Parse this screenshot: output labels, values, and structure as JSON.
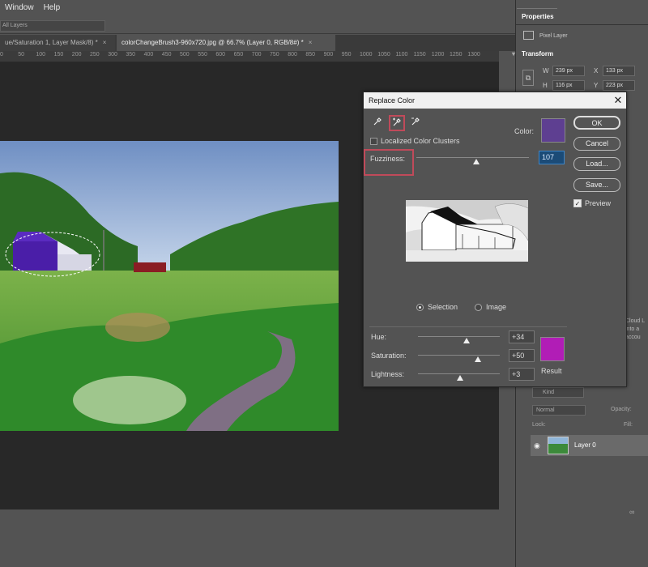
{
  "menu": {
    "items": [
      "Window",
      "Help"
    ]
  },
  "options_bar": {
    "layers_dropdown": "All Layers"
  },
  "tabs": [
    {
      "label": "ue/Saturation 1, Layer Mask/8) *"
    },
    {
      "label": "colorChangeBrush3-960x720.jpg @ 66.7% (Layer 0, RGB/8#) *"
    }
  ],
  "tab_close_glyph": "×",
  "ruler": {
    "ticks": [
      "0",
      "50",
      "100",
      "150",
      "200",
      "250",
      "300",
      "350",
      "400",
      "450",
      "500",
      "550",
      "600",
      "650",
      "700",
      "750",
      "800",
      "850",
      "900",
      "950",
      "1000",
      "1050",
      "1100",
      "1150",
      "1200",
      "1250",
      "1300"
    ]
  },
  "properties": {
    "tab": "Properties",
    "subtitle": "Pixel Layer",
    "transform_title": "Transform",
    "w_label": "W",
    "w_value": "239 px",
    "h_label": "H",
    "h_value": "116 px",
    "x_label": "X",
    "x_value": "133 px",
    "y_label": "Y",
    "y_value": "223 px"
  },
  "layers": {
    "kind": "Kind",
    "blend_mode": "Normal",
    "opacity_label": "Opacity:",
    "lock_label": "Lock:",
    "fill_label": "Fill:",
    "layer_name": "Layer 0",
    "cloud_text": "Cloud L\ninto a \naccou"
  },
  "dialog": {
    "title": "Replace Color",
    "close_glyph": "✕",
    "color_label": "Color:",
    "color_value": "#5e3f91",
    "localized_label": "Localized Color Clusters",
    "fuzziness_label": "Fuzziness:",
    "fuzziness_value": "107",
    "fuzziness_fraction": 0.53,
    "buttons": {
      "ok": "OK",
      "cancel": "Cancel",
      "load": "Load...",
      "save": "Save..."
    },
    "preview_label": "Preview",
    "preview_checked": true,
    "radio_selection": "Selection",
    "radio_image": "Image",
    "selected_mode": "Selection",
    "hue_label": "Hue:",
    "hue_value": "+34",
    "hue_fraction": 0.59,
    "saturation_label": "Saturation:",
    "saturation_value": "+50",
    "saturation_fraction": 0.73,
    "lightness_label": "Lightness:",
    "lightness_value": "+3",
    "lightness_fraction": 0.51,
    "result_label": "Result",
    "result_color": "#b11db6"
  },
  "icons": {
    "eyedropper": "eyedropper-icon",
    "eyedropper_plus": "eyedropper-add-icon",
    "eyedropper_minus": "eyedropper-subtract-icon",
    "check": "✓",
    "eye": "◉",
    "link": "∞"
  }
}
